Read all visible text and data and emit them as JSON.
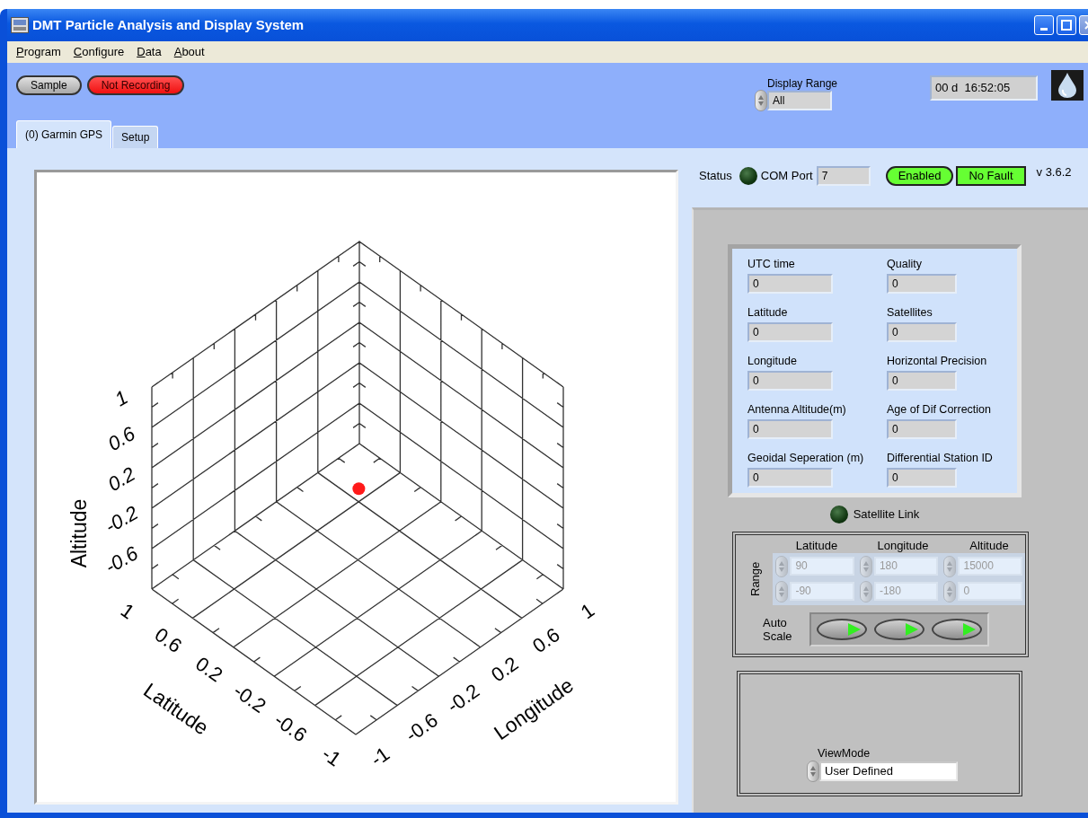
{
  "window": {
    "title": "DMT Particle Analysis and Display System"
  },
  "menu": [
    {
      "label": "Program"
    },
    {
      "label": "Configure"
    },
    {
      "label": "Data"
    },
    {
      "label": "About"
    }
  ],
  "toolbar": {
    "buttons": [
      {
        "label": "Sample",
        "kind": "neutral"
      },
      {
        "label": "Not Recording",
        "kind": "alarm"
      }
    ],
    "display_range": {
      "label": "Display Range",
      "value": "All"
    },
    "elapsed": "00 d  16:52:05"
  },
  "tabs": [
    {
      "label": "(0) Garmin GPS",
      "selected": true
    },
    {
      "label": "Setup",
      "selected": false
    }
  ],
  "plot": {
    "axes": [
      {
        "kind": "vertical",
        "title": "Altitude",
        "tick_labels": [
          "1",
          "0.6",
          "0.2",
          "-0.2",
          "-0.6"
        ]
      },
      {
        "kind": "left",
        "title": "Latitude",
        "tick_labels": [
          "1",
          "0.6",
          "0.2",
          "-0.2",
          "-0.6",
          "-1"
        ]
      },
      {
        "kind": "right",
        "title": "Longitude",
        "tick_labels": [
          "-1",
          "-0.6",
          "-0.2",
          "0.2",
          "0.6",
          "1"
        ]
      }
    ]
  },
  "status": {
    "label": "Status",
    "on": false,
    "com_port_label": "COM Port",
    "com_port": "7",
    "enabled": {
      "label": "Enabled",
      "on": true
    },
    "fault": {
      "label": "No Fault",
      "on": true
    },
    "version": "v 3.6.2"
  },
  "gps_fields": [
    {
      "label": "UTC time",
      "value": "0"
    },
    {
      "label": "Quality",
      "value": "0"
    },
    {
      "label": "Latitude",
      "value": "0"
    },
    {
      "label": "Satellites",
      "value": "0"
    },
    {
      "label": "Longitude",
      "value": "0"
    },
    {
      "label": "Horizontal Precision",
      "value": "0"
    },
    {
      "label": "Antenna Altitude(m)",
      "value": "0"
    },
    {
      "label": "Age of Dif Correction",
      "value": "0"
    },
    {
      "label": "Geoidal Seperation (m)",
      "value": "0"
    },
    {
      "label": "Differential Station ID",
      "value": "0"
    }
  ],
  "satellite_link": {
    "label": "Satellite Link",
    "on": false
  },
  "range": {
    "label": "Range",
    "auto_scale_label": "Auto Scale",
    "columns": [
      {
        "title": "Latitude",
        "max": "90",
        "min": "-90",
        "disabled": true
      },
      {
        "title": "Longitude",
        "max": "180",
        "min": "-180",
        "disabled": true
      },
      {
        "title": "Altitude",
        "max": "15000",
        "min": "0",
        "disabled": true
      }
    ]
  },
  "view_mode": {
    "label": "ViewMode",
    "value": "User Defined"
  }
}
